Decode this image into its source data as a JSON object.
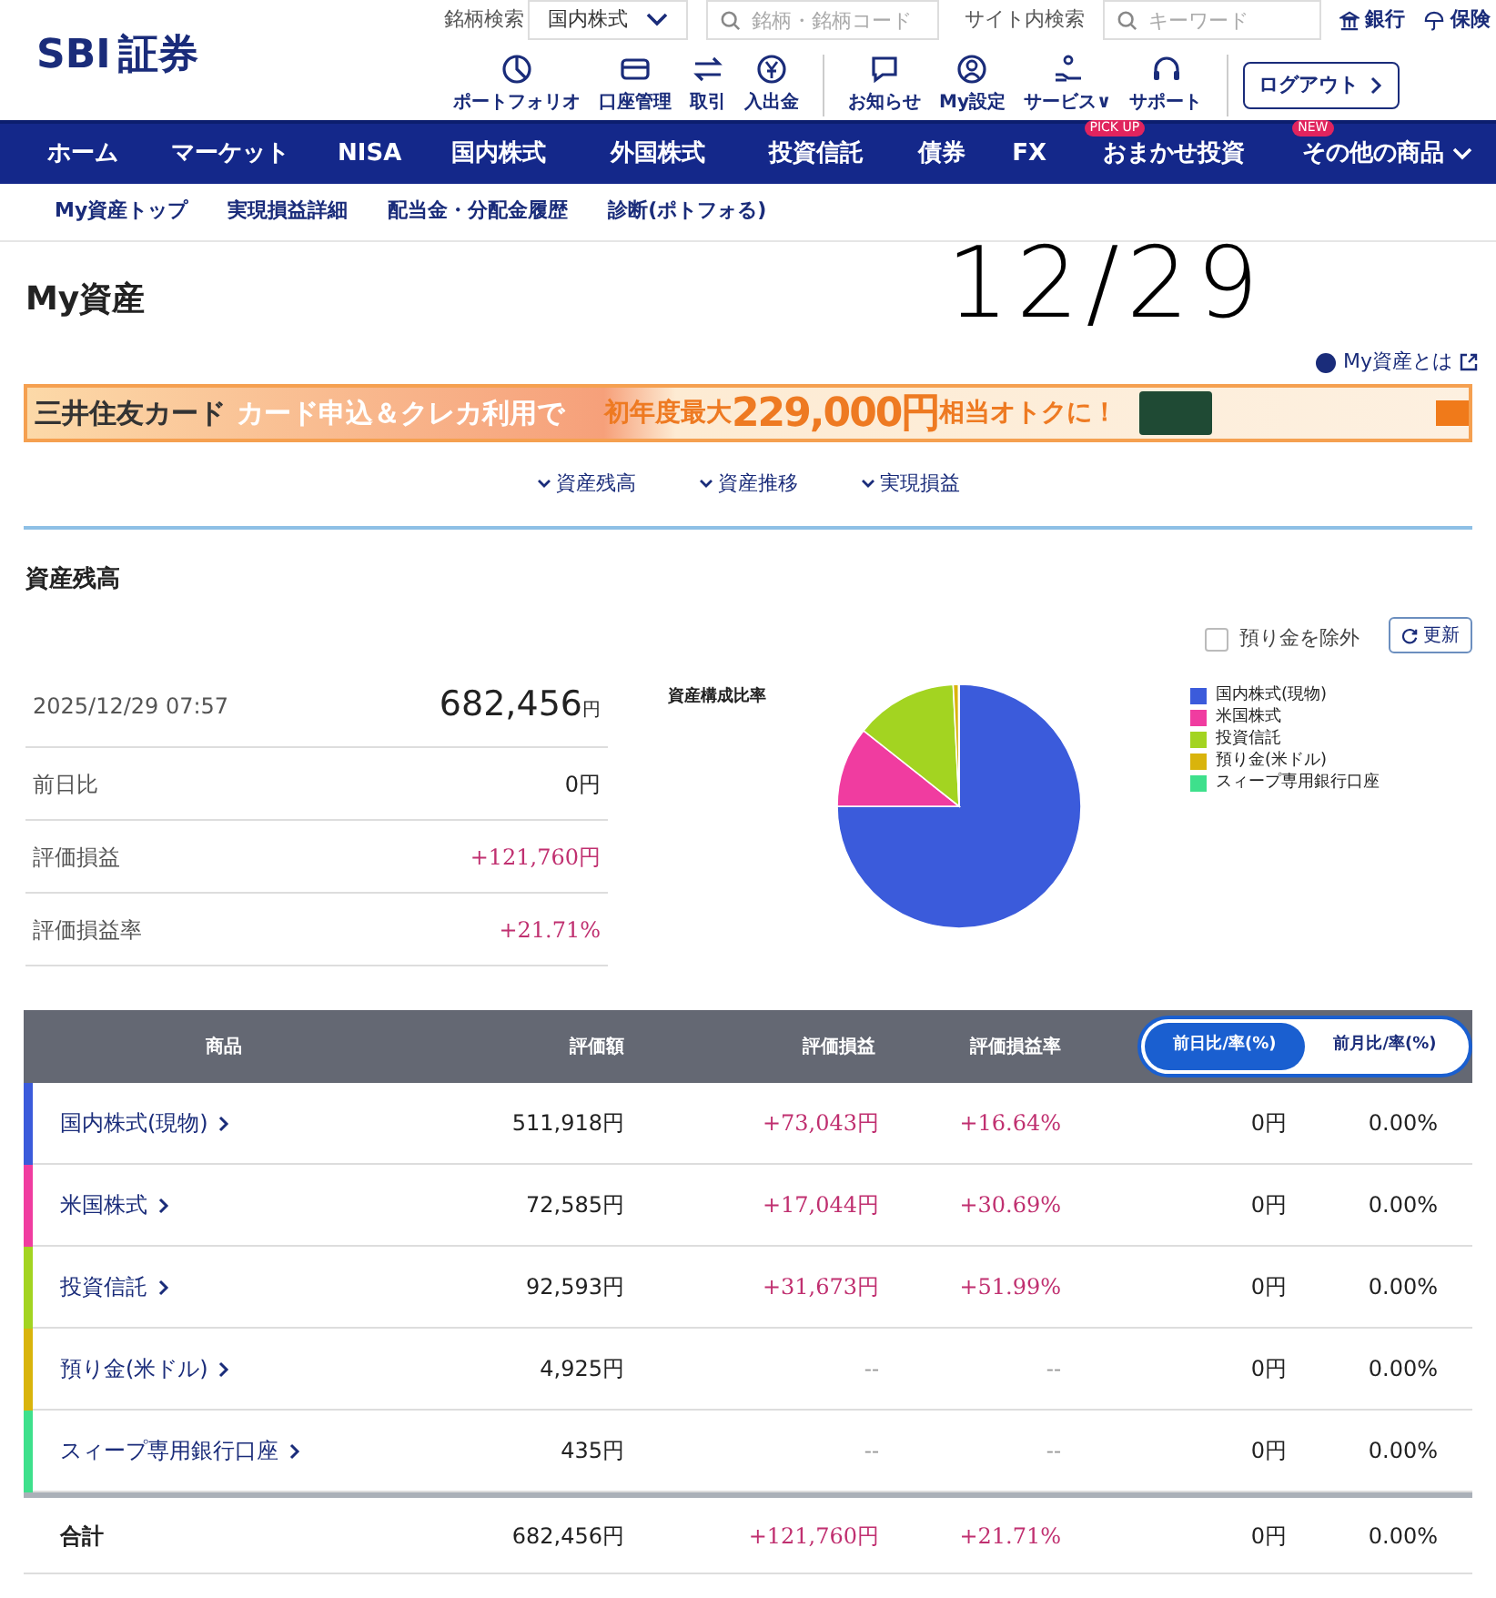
{
  "logo": {
    "latin": "SBI",
    "kanji": "証券"
  },
  "search": {
    "stock_label": "銘柄検索",
    "market": "国内株式",
    "stock_placeholder": "銘柄・銘柄コード",
    "site_label": "サイト内検索",
    "site_placeholder": "キーワード"
  },
  "top_links": [
    "銀行",
    "保険"
  ],
  "shortcuts": [
    {
      "label": "ポートフォリオ"
    },
    {
      "label": "口座管理"
    },
    {
      "label": "取引"
    },
    {
      "label": "入出金"
    },
    {
      "label": "お知らせ"
    },
    {
      "label": "My設定"
    },
    {
      "label": "サービス∨"
    },
    {
      "label": "サポート"
    }
  ],
  "logout": "ログアウト",
  "main_nav": [
    {
      "label": "ホーム"
    },
    {
      "label": "マーケット"
    },
    {
      "label": "NISA"
    },
    {
      "label": "国内株式"
    },
    {
      "label": "外国株式"
    },
    {
      "label": "投資信託"
    },
    {
      "label": "債券"
    },
    {
      "label": "FX"
    },
    {
      "label": "おまかせ投資",
      "badge": "PICK UP"
    },
    {
      "label": "その他の商品",
      "badge": "NEW"
    }
  ],
  "sub_nav": [
    "My資産トップ",
    "実現損益詳細",
    "配当金・分配金履歴",
    "診断(ポトフォる)"
  ],
  "handwritten_note": "12/29",
  "page_title": "My資産",
  "help_link": "My資産とは",
  "banner": {
    "left": "三井住友カード",
    "middle": "カード申込＆クレカ利用で",
    "prefix": "初年度最大",
    "amount": "229,000円",
    "suffix": "相当オトクに！"
  },
  "anchors": [
    "資産残高",
    "資産推移",
    "実現損益"
  ],
  "section_title": "資産残高",
  "exclude_deposit": {
    "label": "預り金を除外",
    "checked": false
  },
  "refresh": "更新",
  "summary": {
    "datetime": "2025/12/29 07:57",
    "total": "682,456",
    "unit": "円",
    "rows": [
      {
        "label": "前日比",
        "value": "0円",
        "kind": "plain"
      },
      {
        "label": "評価損益",
        "value": "+121,760円",
        "kind": "gain"
      },
      {
        "label": "評価損益率",
        "value": "+21.71%",
        "kind": "gain"
      }
    ]
  },
  "chart_data": {
    "type": "pie",
    "title": "資産構成比率",
    "categories": [
      "国内株式(現物)",
      "米国株式",
      "投資信託",
      "預り金(米ドル)",
      "スィープ専用銀行口座"
    ],
    "series": [
      {
        "values": [
          75.01,
          10.64,
          13.57,
          0.72,
          0.06
        ]
      }
    ],
    "colors": [
      "#3b5bdb",
      "#f03ca0",
      "#a3d421",
      "#d9b40c",
      "#3ee08c"
    ]
  },
  "table": {
    "columns": [
      "商品",
      "評価額",
      "評価損益",
      "評価損益率"
    ],
    "toggle": [
      {
        "label": "前日比/率(%)",
        "selected": true
      },
      {
        "label": "前月比/率(%)",
        "selected": false
      }
    ],
    "rows": [
      {
        "name": "国内株式(現物)",
        "value": "511,918円",
        "gain": "+73,043円",
        "rate": "+16.64%",
        "diff": "0円",
        "diff_rate": "0.00%",
        "color": "#3b5bdb"
      },
      {
        "name": "米国株式",
        "value": "72,585円",
        "gain": "+17,044円",
        "rate": "+30.69%",
        "diff": "0円",
        "diff_rate": "0.00%",
        "color": "#f03ca0"
      },
      {
        "name": "投資信託",
        "value": "92,593円",
        "gain": "+31,673円",
        "rate": "+51.99%",
        "diff": "0円",
        "diff_rate": "0.00%",
        "color": "#a3d421"
      },
      {
        "name": "預り金(米ドル)",
        "value": "4,925円",
        "gain": "--",
        "rate": "--",
        "diff": "0円",
        "diff_rate": "0.00%",
        "color": "#d9b40c"
      },
      {
        "name": "スィープ専用銀行口座",
        "value": "435円",
        "gain": "--",
        "rate": "--",
        "diff": "0円",
        "diff_rate": "0.00%",
        "color": "#3ee08c"
      }
    ],
    "total": {
      "name": "合計",
      "value": "682,456円",
      "gain": "+121,760円",
      "rate": "+21.71%",
      "diff": "0円",
      "diff_rate": "0.00%"
    }
  }
}
